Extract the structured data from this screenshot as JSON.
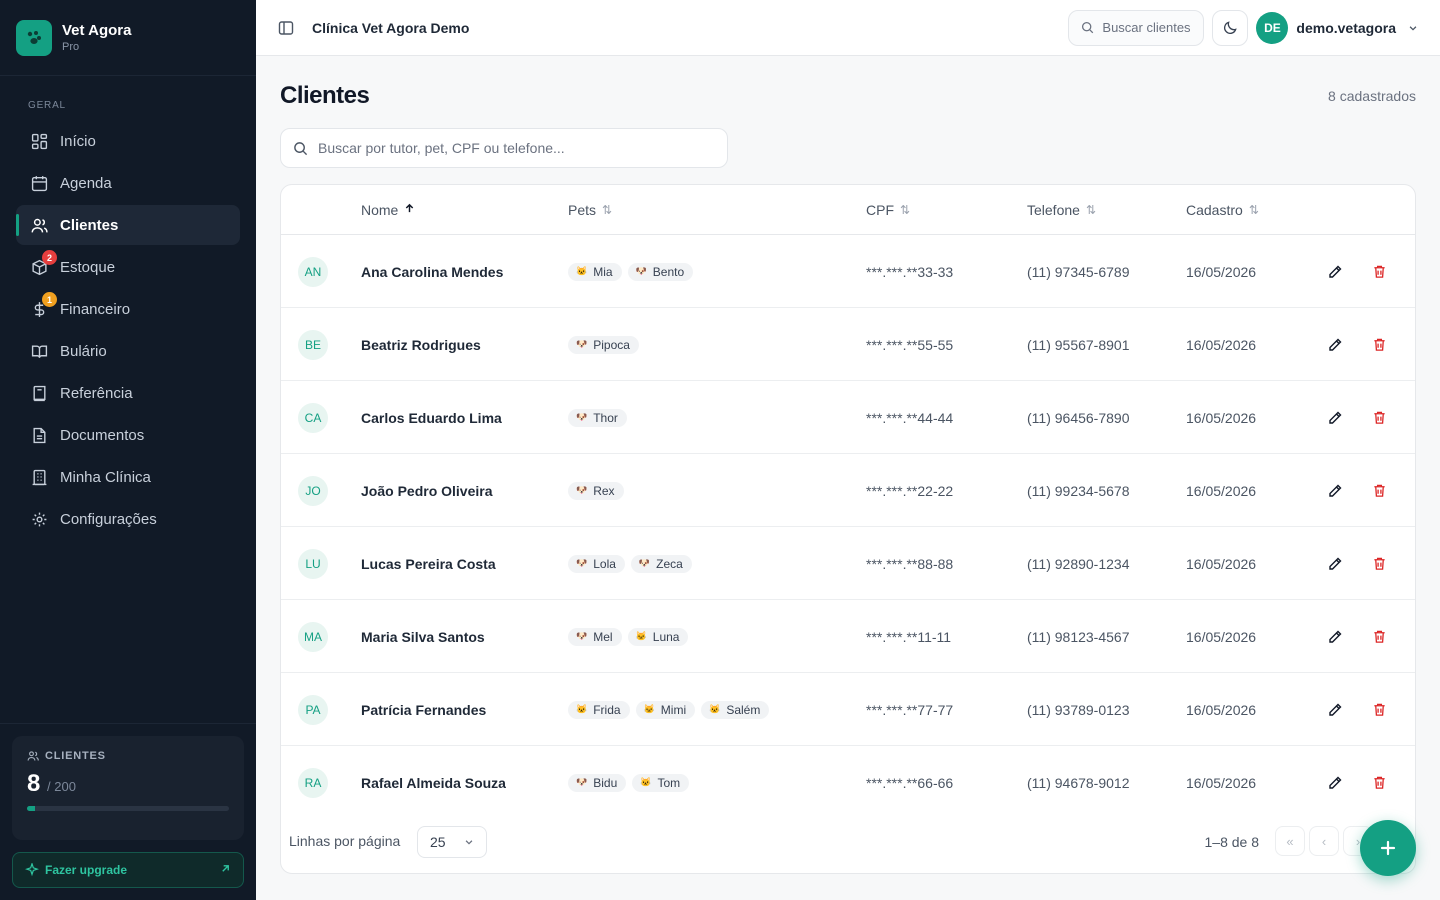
{
  "brand": {
    "name": "Vet Agora",
    "plan": "Pro"
  },
  "nav": {
    "section_title": "GERAL",
    "items": [
      {
        "label": "Início",
        "icon": "dashboard-icon"
      },
      {
        "label": "Agenda",
        "icon": "calendar-icon"
      },
      {
        "label": "Clientes",
        "icon": "users-icon",
        "active": true
      },
      {
        "label": "Estoque",
        "icon": "box-icon",
        "badge": "2"
      },
      {
        "label": "Financeiro",
        "icon": "dollar-icon",
        "badge": "1"
      },
      {
        "label": "Bulário",
        "icon": "book-open-icon"
      },
      {
        "label": "Referência",
        "icon": "book-icon"
      },
      {
        "label": "Documentos",
        "icon": "file-icon"
      },
      {
        "label": "Minha Clínica",
        "icon": "building-icon"
      },
      {
        "label": "Configurações",
        "icon": "gear-icon"
      }
    ]
  },
  "usage": {
    "title": "CLIENTES",
    "count": "8",
    "limit": "/ 200",
    "fraction": 0.04
  },
  "upgrade_label": "Fazer upgrade",
  "topbar": {
    "clinic": "Clínica Vet Agora Demo",
    "search_label": "Buscar clientes",
    "avatar_initials": "DE",
    "user": "demo.vetagora"
  },
  "page": {
    "title": "Clientes",
    "count": "8 cadastrados",
    "search_placeholder": "Buscar por tutor, pet, CPF ou telefone..."
  },
  "table": {
    "headers": {
      "name": "Nome",
      "pets": "Pets",
      "cpf": "CPF",
      "phone": "Telefone",
      "created": "Cadastro"
    },
    "rows": [
      {
        "ini": "AN",
        "name": "Ana Carolina Mendes",
        "pets": [
          [
            "Mia",
            "cat"
          ],
          [
            "Bento",
            "dog"
          ]
        ],
        "cpf": "***.***.**33-33",
        "phone": "(11) 97345-6789",
        "date": "16/05/2026"
      },
      {
        "ini": "BE",
        "name": "Beatriz Rodrigues",
        "pets": [
          [
            "Pipoca",
            "dog"
          ]
        ],
        "cpf": "***.***.**55-55",
        "phone": "(11) 95567-8901",
        "date": "16/05/2026"
      },
      {
        "ini": "CA",
        "name": "Carlos Eduardo Lima",
        "pets": [
          [
            "Thor",
            "dog"
          ]
        ],
        "cpf": "***.***.**44-44",
        "phone": "(11) 96456-7890",
        "date": "16/05/2026"
      },
      {
        "ini": "JO",
        "name": "João Pedro Oliveira",
        "pets": [
          [
            "Rex",
            "dog"
          ]
        ],
        "cpf": "***.***.**22-22",
        "phone": "(11) 99234-5678",
        "date": "16/05/2026"
      },
      {
        "ini": "LU",
        "name": "Lucas Pereira Costa",
        "pets": [
          [
            "Lola",
            "dog"
          ],
          [
            "Zeca",
            "dog"
          ]
        ],
        "cpf": "***.***.**88-88",
        "phone": "(11) 92890-1234",
        "date": "16/05/2026"
      },
      {
        "ini": "MA",
        "name": "Maria Silva Santos",
        "pets": [
          [
            "Mel",
            "dog"
          ],
          [
            "Luna",
            "cat"
          ]
        ],
        "cpf": "***.***.**11-11",
        "phone": "(11) 98123-4567",
        "date": "16/05/2026"
      },
      {
        "ini": "PA",
        "name": "Patrícia Fernandes",
        "pets": [
          [
            "Frida",
            "cat"
          ],
          [
            "Mimi",
            "cat"
          ],
          [
            "Salém",
            "cat"
          ]
        ],
        "cpf": "***.***.**77-77",
        "phone": "(11) 93789-0123",
        "date": "16/05/2026"
      },
      {
        "ini": "RA",
        "name": "Rafael Almeida Souza",
        "pets": [
          [
            "Bidu",
            "dog"
          ],
          [
            "Tom",
            "cat"
          ]
        ],
        "cpf": "***.***.**66-66",
        "phone": "(11) 94678-9012",
        "date": "16/05/2026"
      }
    ]
  },
  "pagination": {
    "rows_label": "Linhas por página",
    "rows_value": "25",
    "range": "1–8 de 8"
  },
  "colors": {
    "accent": "#14a083",
    "sidebar": "#111a27",
    "danger": "#dc2626"
  }
}
